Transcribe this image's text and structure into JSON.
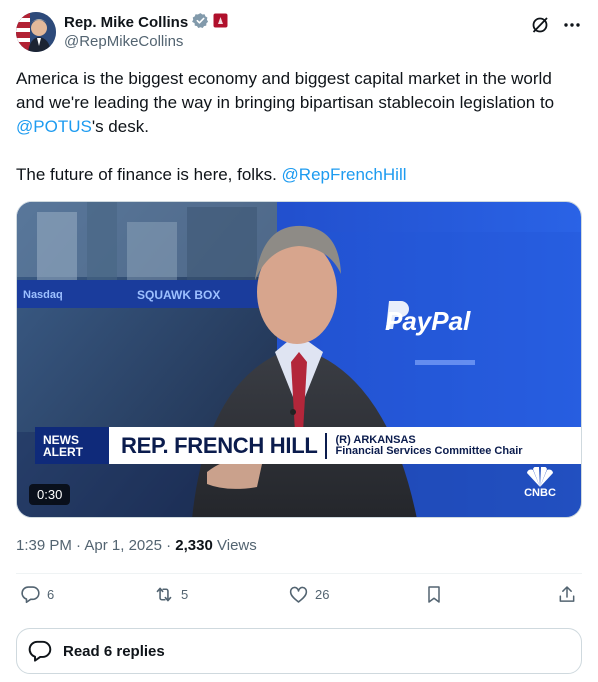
{
  "author": {
    "display_name": "Rep. Mike Collins",
    "handle": "@RepMikeCollins",
    "verified_badge_color": "#829aab",
    "affiliate_badge_color": "#b0102c"
  },
  "tweet": {
    "line1_text": "America is the biggest economy and biggest capital market in the world and we're leading the way in bringing bipartisan stablecoin legislation to ",
    "line1_mention": "@POTUS",
    "line1_suffix": "'s desk.",
    "line2_text": "The future of finance is here, folks. ",
    "line2_mention": "@RepFrenchHill"
  },
  "media": {
    "ticker_left": "Nasdaq",
    "show_name": "SQUAWK BOX",
    "brand_logo_text": "PayPal",
    "news_alert_line1": "NEWS",
    "news_alert_line2": "ALERT",
    "chyron_name": "REP. FRENCH HILL",
    "chyron_party": "(R) ARKANSAS",
    "chyron_title": "Financial Services Committee Chair",
    "network": "CNBC",
    "duration": "0:30"
  },
  "meta": {
    "time": "1:39 PM",
    "date": "Apr 1, 2025",
    "views_count": "2,330",
    "views_label": "Views"
  },
  "actions": {
    "replies": "6",
    "reposts": "5",
    "likes": "26"
  },
  "read_replies_label": "Read 6 replies",
  "colors": {
    "accent": "#1d9bf0",
    "text_primary": "#0f1419",
    "text_secondary": "#536471"
  }
}
